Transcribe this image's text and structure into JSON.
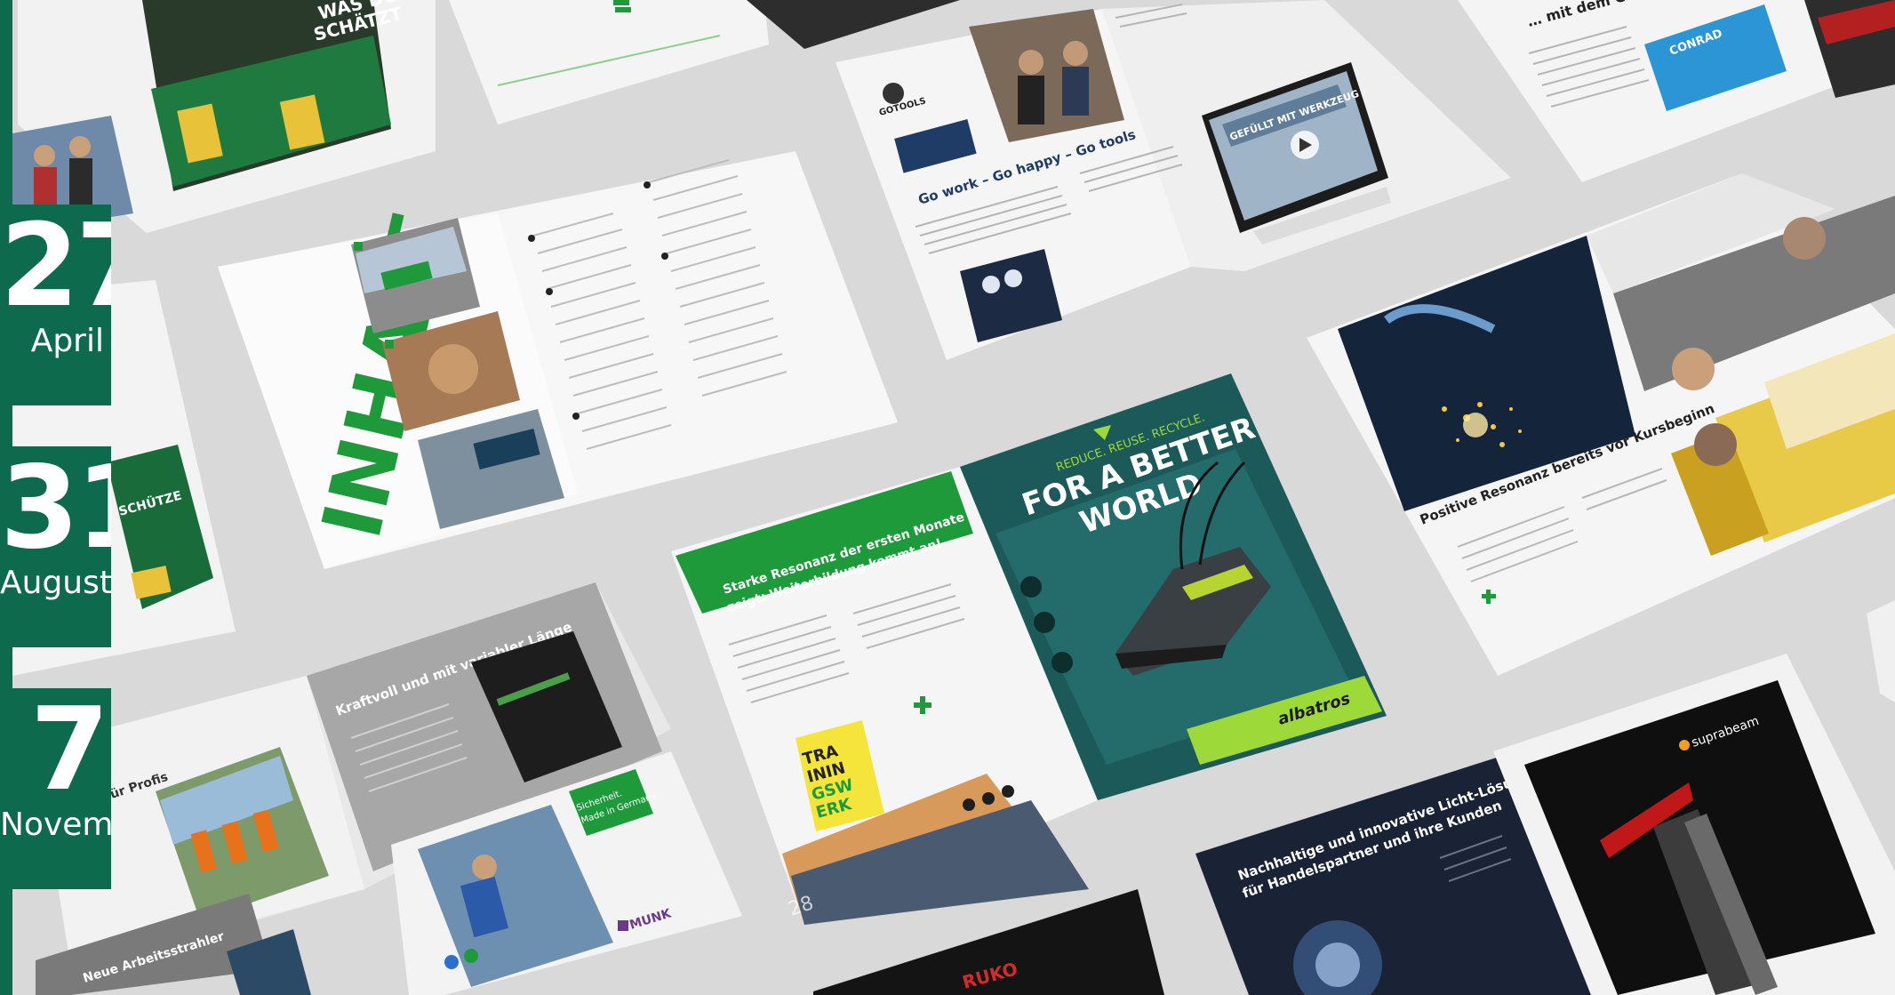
{
  "scene": {
    "background": "#d9d9d9",
    "brand_green": "#0e6a4d",
    "accent_green": "#1f9a3a"
  },
  "dates": [
    {
      "day": "27",
      "month": "April"
    },
    {
      "day": "31",
      "month": "August"
    },
    {
      "day": "7",
      "month": "November"
    }
  ],
  "spreads": {
    "inhalt": {
      "heading": "INHALT"
    },
    "gotools": {
      "logo": "GOTOOLS",
      "headline": "Go work – Go happy – Go tools",
      "video_label": "GEFÜLLT MIT WERKZEUG"
    },
    "conrad": {
      "headline": "… mit dem Conrad",
      "logo": "CONRAD"
    },
    "training": {
      "headline_1": "Starke Resonanz der ersten Monate",
      "headline_2": "zeigt: Weiterbildung kommt an!",
      "badge": [
        "TRA",
        "ININ",
        "GSW",
        "ERK"
      ],
      "page_number": "28"
    },
    "albatros": {
      "tagline": "REDUCE. REUSE. RECYCLE.",
      "headline_1": "FOR A BETTER",
      "headline_2": "WORLD",
      "brand": "albatros"
    },
    "welding": {
      "headline": "Positive Resonanz bereits vor Kursbeginn"
    },
    "kraftvoll": {
      "headline": "Kraftvoll und mit variabler Länge",
      "side_headline": "für Profis",
      "sub_headline": "Neue Arbeitsstrahler"
    },
    "munk": {
      "brand": "MUNK",
      "badge_1": "Sicherheit.",
      "badge_2": "Made in Germany."
    },
    "licht": {
      "headline_1": "Nachhaltige und innovative Licht-Lösungen",
      "headline_2": "für Handelspartner und ihre Kunden"
    },
    "suprabeam": {
      "brand": "suprabeam"
    },
    "ruko": {
      "brand": "RUKO"
    },
    "schuetze": {
      "lines": [
        "SCHÜTZE",
        "WAS DU",
        "SCHÄTZT"
      ]
    }
  }
}
